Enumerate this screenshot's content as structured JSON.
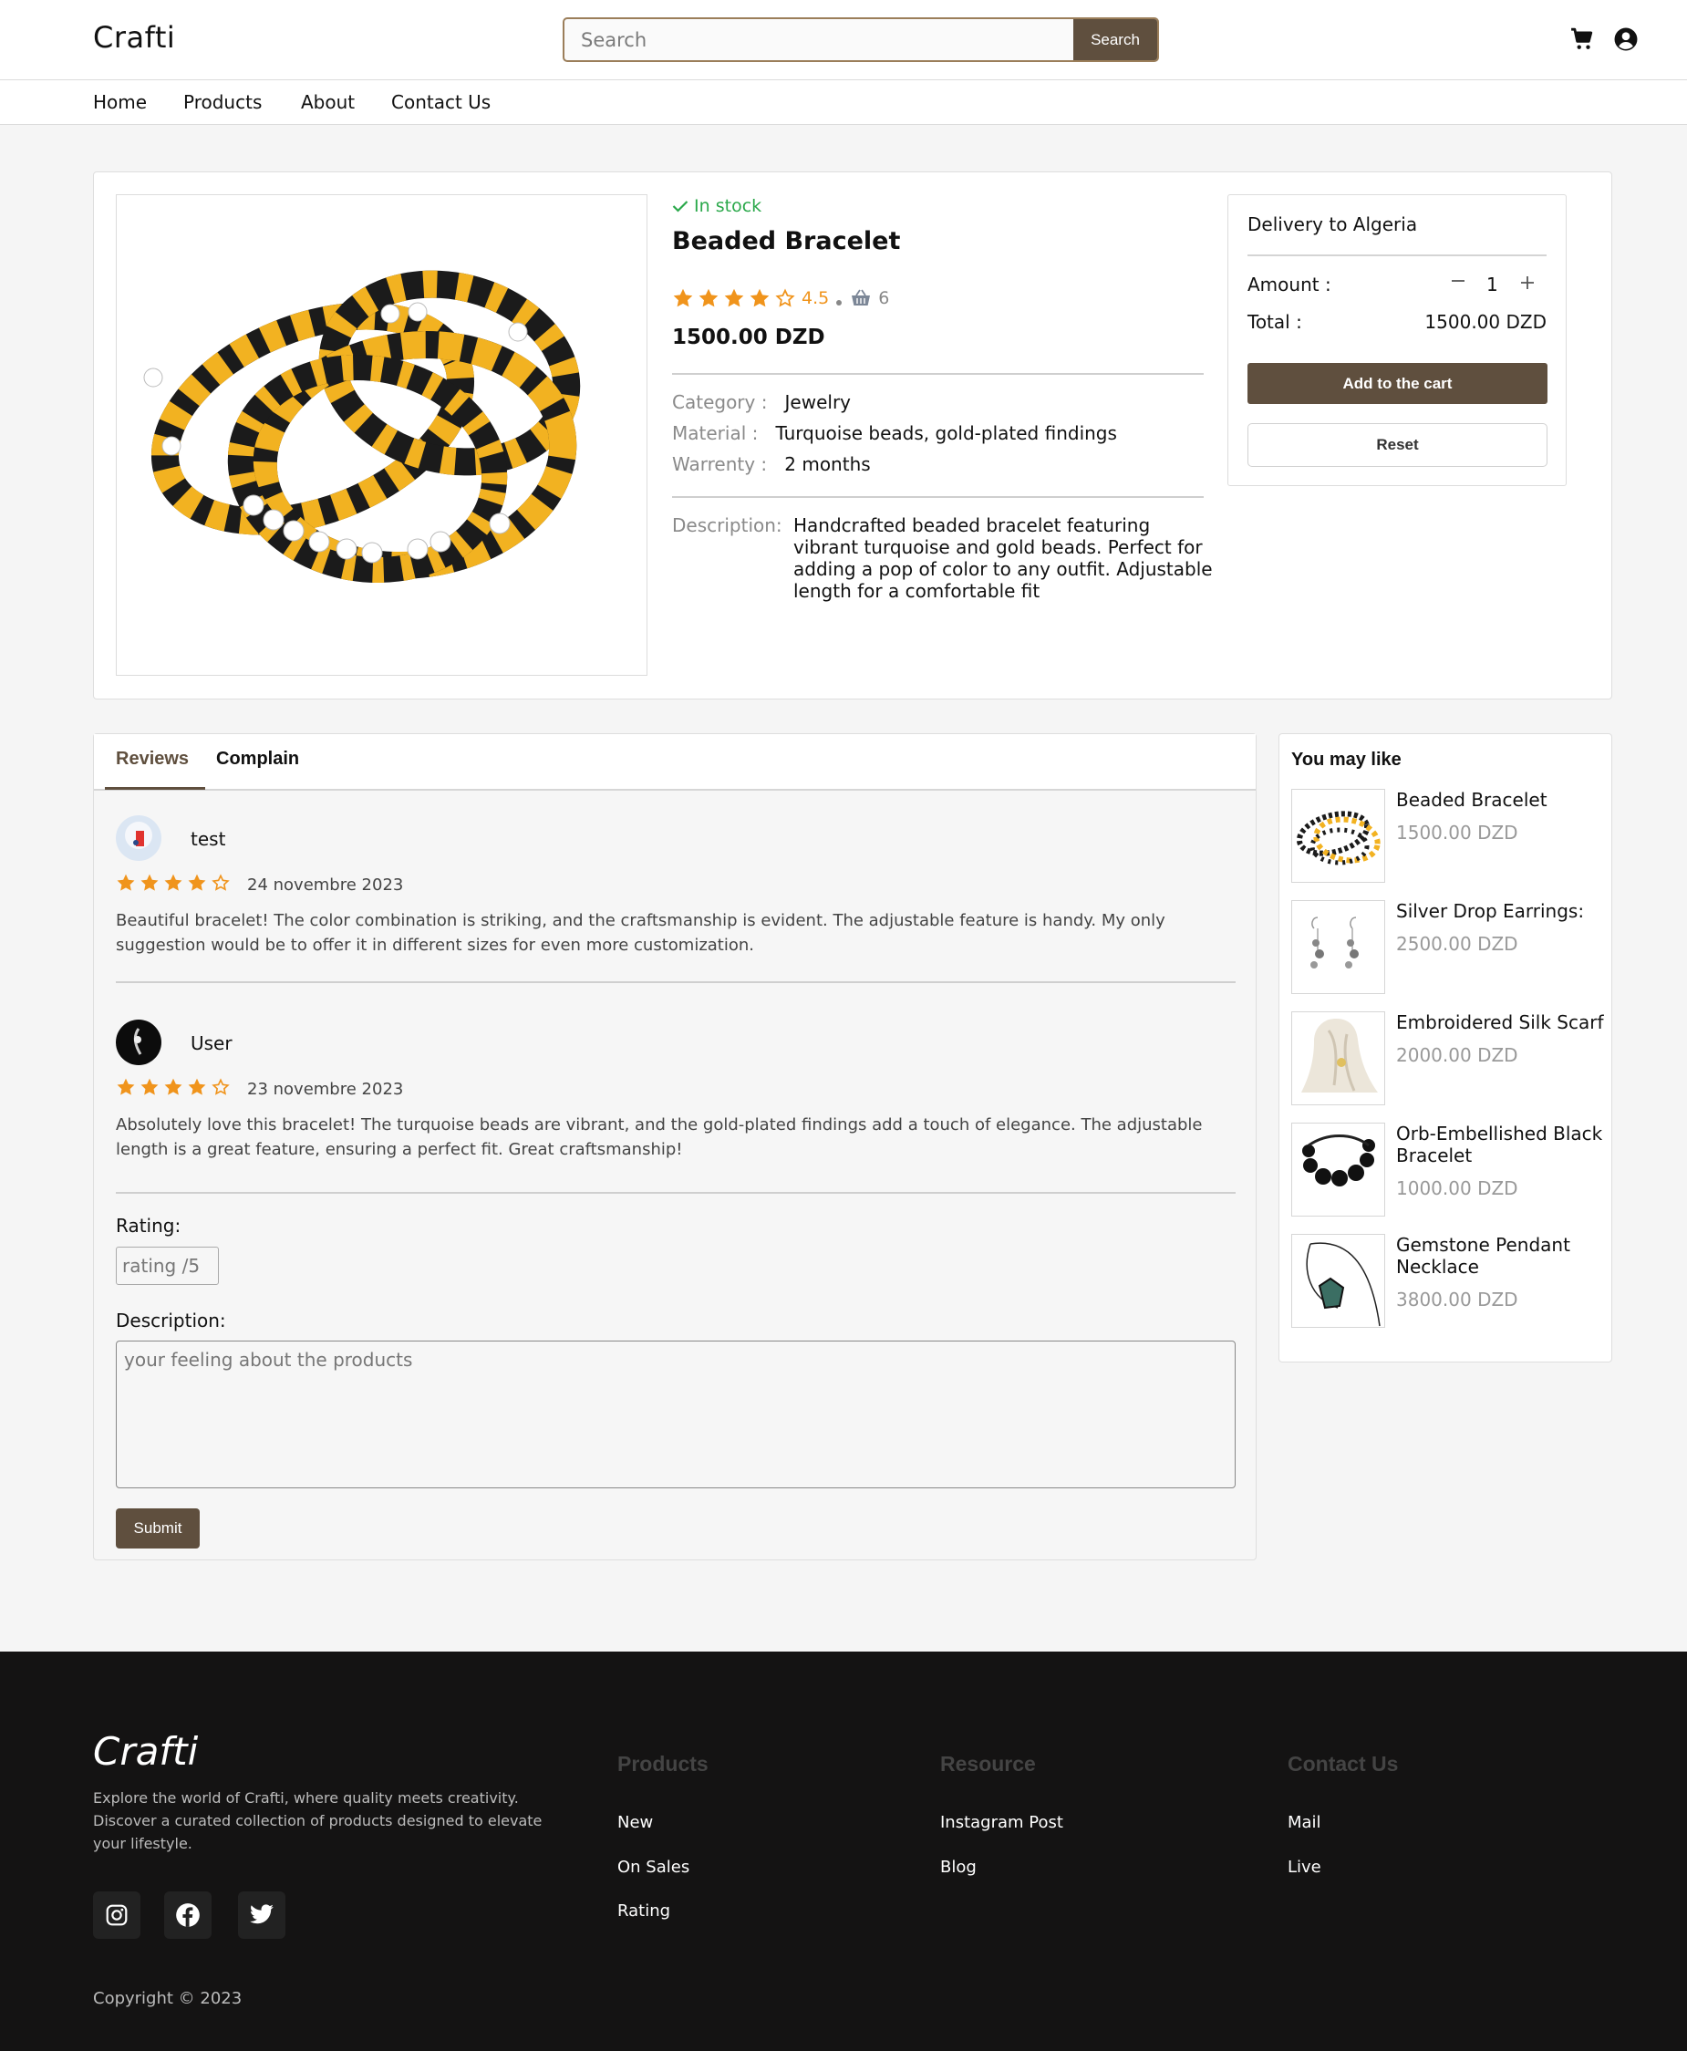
{
  "header": {
    "logo": "Crafti",
    "search_placeholder": "Search",
    "search_button": "Search",
    "icons": [
      "cart-icon",
      "user-circle-icon"
    ]
  },
  "nav": {
    "items": [
      "Home",
      "Products",
      "About",
      "Contact Us"
    ]
  },
  "product": {
    "stock": "In stock",
    "title": "Beaded Bracelet",
    "rating": "4.5",
    "rating_stars": 4.5,
    "sold": "6",
    "price": "1500.00 DZD",
    "category_label": "Category :",
    "category": "Jewelry",
    "material_label": "Material :",
    "material": "Turquoise beads, gold-plated findings",
    "warranty_label": "Warrenty :",
    "warranty": "2 months",
    "description_label": "Description:",
    "description": "Handcrafted beaded bracelet featuring vibrant turquoise and gold beads. Perfect for adding a pop of color to any outfit. Adjustable length for a comfortable fit"
  },
  "delivery": {
    "title": "Delivery to Algeria",
    "amount_label": "Amount :",
    "quantity": "1",
    "total_label": "Total :",
    "total": "1500.00 DZD",
    "add_to_cart": "Add to the cart",
    "reset": "Reset"
  },
  "tabs": [
    "Reviews",
    "Complain"
  ],
  "reviews": [
    {
      "user": "test",
      "stars": 4,
      "date": "24 novembre 2023",
      "text": "Beautiful bracelet! The color combination is striking, and the craftsmanship is evident. The adjustable feature is handy. My only suggestion would be to offer it in different sizes for even more customization."
    },
    {
      "user": "User",
      "stars": 4,
      "date": "23 novembre 2023",
      "text": "Absolutely love this bracelet! The turquoise beads are vibrant, and the gold-plated findings add a touch of elegance. The adjustable length is a great feature, ensuring a perfect fit. Great craftsmanship!"
    }
  ],
  "review_form": {
    "rating_label": "Rating:",
    "rating_placeholder": "rating /5",
    "description_label": "Description:",
    "description_placeholder": "your feeling about the products",
    "submit": "Submit"
  },
  "you_may_like": {
    "title": "You may like",
    "items": [
      {
        "name": "Beaded Bracelet",
        "price": "1500.00 DZD"
      },
      {
        "name": "Silver Drop Earrings:",
        "price": "2500.00 DZD"
      },
      {
        "name": "Embroidered Silk Scarf",
        "price": "2000.00 DZD"
      },
      {
        "name": "Orb-Embellished Black Bracelet",
        "price": "1000.00 DZD"
      },
      {
        "name": "Gemstone Pendant Necklace",
        "price": "3800.00 DZD"
      }
    ]
  },
  "footer": {
    "logo": "Crafti",
    "about": "Explore the world of Crafti, where quality meets creativity. Discover a curated collection of products designed to elevate your lifestyle.",
    "social_icons": [
      "instagram-icon",
      "facebook-icon",
      "twitter-icon"
    ],
    "columns": [
      {
        "title": "Products",
        "links": [
          "New",
          "On Sales",
          "Rating"
        ]
      },
      {
        "title": "Resource",
        "links": [
          "Instagram Post",
          "Blog"
        ]
      },
      {
        "title": "Contact Us",
        "links": [
          "Mail",
          "Live"
        ]
      }
    ],
    "copyright": "Copyright © 2023"
  },
  "colors": {
    "brand_brown": "#5f4f3e",
    "star_orange": "#f0941c",
    "stock_green": "#2aa84a",
    "footer_bg": "#141313"
  }
}
